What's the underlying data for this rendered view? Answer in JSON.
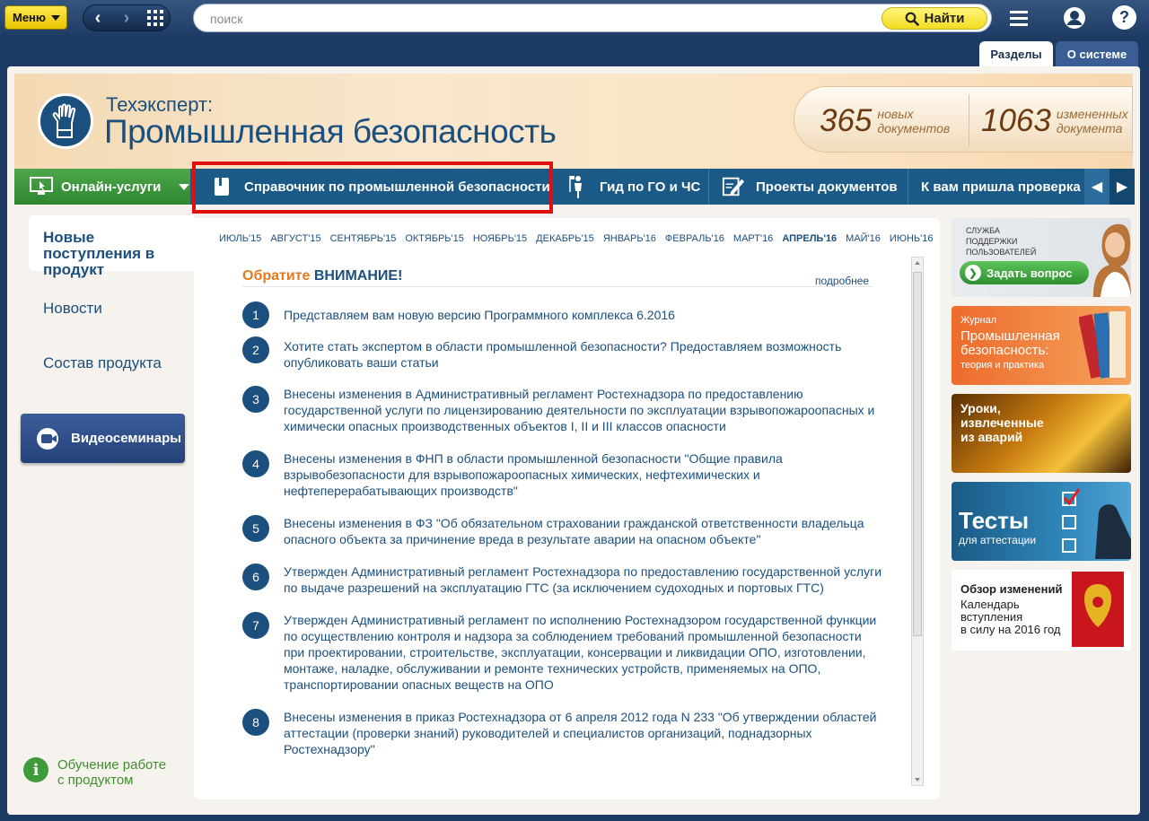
{
  "topbar": {
    "menu_label": "Меню",
    "search_placeholder": "поиск",
    "find_label": "Найти",
    "icons": [
      "back-arrow-icon",
      "forward-arrow-icon",
      "grid-icon",
      "hamburger-icon",
      "user-icon",
      "help-icon"
    ]
  },
  "right_tabs": [
    {
      "label": "Разделы",
      "active": true
    },
    {
      "label": "О системе",
      "active": false
    }
  ],
  "header": {
    "subtitle": "Техэксперт:",
    "title": "Промышленная безопасность",
    "counters": [
      {
        "number": "365",
        "label_line1": "новых",
        "label_line2": "документов"
      },
      {
        "number": "1063",
        "label_line1": "измененных",
        "label_line2": "документа"
      }
    ]
  },
  "navbar": {
    "online": "Онлайн-услуги",
    "items": [
      {
        "label": "Справочник по промышленной безопасности",
        "icon": "book-icon"
      },
      {
        "label": "Гид по ГО и ЧС",
        "icon": "person-flag-icon"
      },
      {
        "label": "Проекты документов",
        "icon": "edit-document-icon"
      },
      {
        "label": "К вам пришла проверка",
        "icon": ""
      }
    ]
  },
  "left": {
    "active": "Новые поступления в продукт",
    "items": [
      "Новости",
      "Состав продукта"
    ],
    "video_button": "Видеосеминары",
    "learn": "Обучение работе с продуктом"
  },
  "main": {
    "months": [
      "ИЮЛЬ'15",
      "АВГУСТ'15",
      "СЕНТЯБРЬ'15",
      "ОКТЯБРЬ'15",
      "НОЯБРЬ'15",
      "ДЕКАБРЬ'15",
      "ЯНВАРЬ'16",
      "ФЕВРАЛЬ'16",
      "МАРТ'16",
      "АПРЕЛЬ'16",
      "МАЙ'16",
      "ИЮНЬ'16"
    ],
    "current_month": "АПРЕЛЬ'16",
    "attn_orange": "Обратите",
    "attn_blue": "ВНИМАНИЕ!",
    "more": "подробнее",
    "news": [
      {
        "num": "1",
        "text": "Представляем вам новую версию Программного комплекса 6.2016"
      },
      {
        "num": "2",
        "text": "Хотите стать экспертом в области промышленной безопасности? Предоставляем возможность опубликовать ваши статьи"
      },
      {
        "num": "3",
        "text": "Внесены изменения в Административный регламент Ростехнадзора по предоставлению государственной услуги по лицензированию деятельности по эксплуатации взрывопожароопасных и химически опасных производственных объектов I, II и III классов опасности"
      },
      {
        "num": "4",
        "text": "Внесены изменения в ФНП в области промышленной безопасности \"Общие правила взрывобезопасности для взрывопожароопасных химических, нефтехимических и нефтеперерабатывающих производств\""
      },
      {
        "num": "5",
        "text": "Внесены изменения в ФЗ \"Об обязательном страховании гражданской ответственности владельца опасного объекта за причинение вреда в результате аварии на опасном объекте\""
      },
      {
        "num": "6",
        "text": "Утвержден Административный регламент Ростехнадзора по предоставлению государственной услуги по выдаче разрешений на эксплуатацию ГТС (за исключением судоходных и портовых ГТС)"
      },
      {
        "num": "7",
        "text": "Утвержден Административный регламент по исполнению Ростехнадзором государственной функции по осуществлению контроля и надзора за соблюдением требований промышленной безопасности при проектировании, строительстве, эксплуатации, консервации и ликвидации ОПО, изготовлении, монтаже, наладке, обслуживании и ремонте технических устройств, применяемых на ОПО, транспортировании опасных веществ на ОПО"
      },
      {
        "num": "8",
        "text": "Внесены изменения в приказ Ростехнадзора от 6 апреля 2012 года N 233 \"Об утверждении областей аттестации (проверки знаний) руководителей и специалистов организаций, поднадзорных Ростехнадзору\""
      }
    ]
  },
  "right": {
    "support": {
      "line1": "СЛУЖБА",
      "line2": "ПОДДЕРЖКИ",
      "line3": "ПОЛЬЗОВАТЕЛЕЙ",
      "button": "Задать вопрос"
    },
    "journal": {
      "label": "Журнал",
      "title1": "Промышленная",
      "title2": "безопасность:",
      "sub": "теория и практика"
    },
    "lessons": {
      "line1": "Уроки,",
      "line2": "извлеченные",
      "line3": "из аварий"
    },
    "tests": {
      "title": "Тесты",
      "sub": "для аттестации"
    },
    "review": {
      "title": "Обзор изменений",
      "line1": "Календарь",
      "line2": "вступления",
      "line3": "в силу на 2016 год"
    }
  },
  "colors": {
    "brand_blue": "#1b4f7e",
    "accent_orange": "#e8781c",
    "green": "#2f8731",
    "highlight_red": "#e01010"
  }
}
